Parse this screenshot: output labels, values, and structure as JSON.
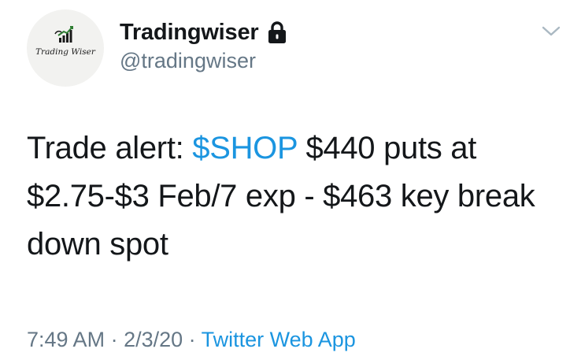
{
  "user": {
    "display_name": "Tradingwiser",
    "handle": "@tradingwiser",
    "avatar_text": "Trading Wiser",
    "protected_icon": "lock-icon"
  },
  "menu": {
    "icon": "chevron-down-icon"
  },
  "tweet": {
    "text_before": "Trade alert: ",
    "cashtag": "$SHOP",
    "text_after": " $440 puts at $2.75-$3 Feb/7 exp - $463 key break down spot"
  },
  "meta": {
    "time": "7:49 AM",
    "separator1": " · ",
    "date": "2/3/20",
    "separator2": " · ",
    "source": "Twitter Web App"
  },
  "colors": {
    "link": "#1b95e0",
    "secondary_text": "#657786",
    "primary_text": "#14171a"
  }
}
